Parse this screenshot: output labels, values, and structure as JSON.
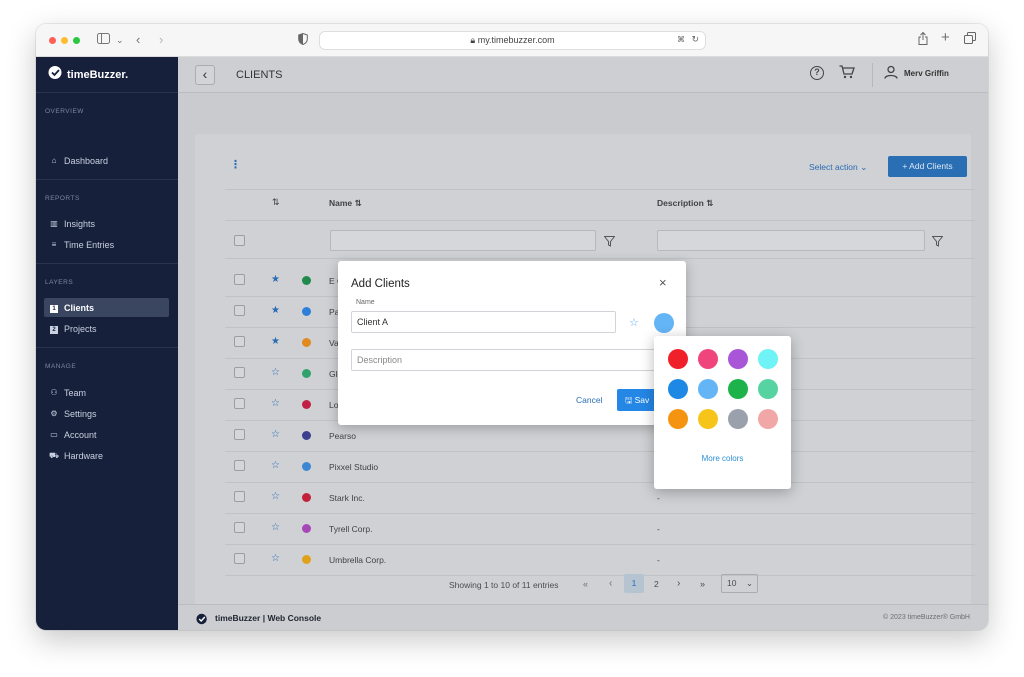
{
  "browser": {
    "url": "my.timebuzzer.com",
    "traffic_lights": [
      "#ff5f57",
      "#febc2e",
      "#28c840"
    ]
  },
  "sidebar": {
    "brand": "timeBuzzer.",
    "sections": [
      {
        "title": "OVERVIEW",
        "items": [
          {
            "label": "Dashboard",
            "icon": "home-icon"
          }
        ]
      },
      {
        "title": "REPORTS",
        "items": [
          {
            "label": "Insights",
            "icon": "bar-chart-icon"
          },
          {
            "label": "Time Entries",
            "icon": "list-icon"
          }
        ]
      },
      {
        "title": "LAYERS",
        "items": [
          {
            "label": "Clients",
            "icon": "layer-1-icon",
            "active": true
          },
          {
            "label": "Projects",
            "icon": "layer-2-icon"
          }
        ]
      },
      {
        "title": "MANAGE",
        "items": [
          {
            "label": "Team",
            "icon": "team-icon"
          },
          {
            "label": "Settings",
            "icon": "gear-icon"
          },
          {
            "label": "Account",
            "icon": "card-icon"
          },
          {
            "label": "Hardware",
            "icon": "cart-icon"
          }
        ]
      }
    ]
  },
  "header": {
    "title": "CLIENTS",
    "user": "Merv Griffin"
  },
  "toolbar": {
    "select_action": "Select action",
    "add_button": "+ Add Clients"
  },
  "table": {
    "columns": {
      "name": "Name",
      "description": "Description"
    },
    "rows": [
      {
        "name": "E Corp.",
        "description": "-",
        "favorite": true,
        "color": "#1f8a4c"
      },
      {
        "name": "Parker",
        "description": "",
        "favorite": true,
        "color": "#2e7fd9"
      },
      {
        "name": "Vader",
        "description": "",
        "favorite": true,
        "color": "#e08a1f"
      },
      {
        "name": "Globe",
        "description": "",
        "favorite": false,
        "color": "#2fa36b"
      },
      {
        "name": "Los Po",
        "description": "",
        "favorite": false,
        "color": "#c21f45"
      },
      {
        "name": "Pearso",
        "description": "",
        "favorite": false,
        "color": "#3a3f8f"
      },
      {
        "name": "Pixxel Studio",
        "description": "-",
        "favorite": false,
        "color": "#3d86d4"
      },
      {
        "name": "Stark Inc.",
        "description": "-",
        "favorite": false,
        "color": "#c4223a"
      },
      {
        "name": "Tyrell Corp.",
        "description": "-",
        "favorite": false,
        "color": "#a648b8"
      },
      {
        "name": "Umbrella Corp.",
        "description": "-",
        "favorite": false,
        "color": "#e0a11a"
      }
    ]
  },
  "pagination": {
    "summary": "Showing 1 to 10 of 11 entries",
    "first": "«",
    "prev": "‹",
    "pages": [
      "1",
      "2"
    ],
    "next": "›",
    "last": "»",
    "page_size": "10"
  },
  "footer": {
    "brand": "timeBuzzer | Web Console",
    "copyright": "© 2023 timeBuzzer® GmbH"
  },
  "modal": {
    "title": "Add Clients",
    "name_label": "Name",
    "name_value": "Client A",
    "description_placeholder": "Description",
    "cancel": "Cancel",
    "save": "Sav",
    "selected_color": "#64b5f6"
  },
  "palette": {
    "colors": [
      "#f0202a",
      "#f0457c",
      "#a855d8",
      "#6ff3f6",
      "#1e88e5",
      "#64b5f6",
      "#1db34a",
      "#57d3a2",
      "#f59410",
      "#f7c51a",
      "#9aa0ac",
      "#f1a7a7"
    ],
    "more_colors": "More colors"
  }
}
